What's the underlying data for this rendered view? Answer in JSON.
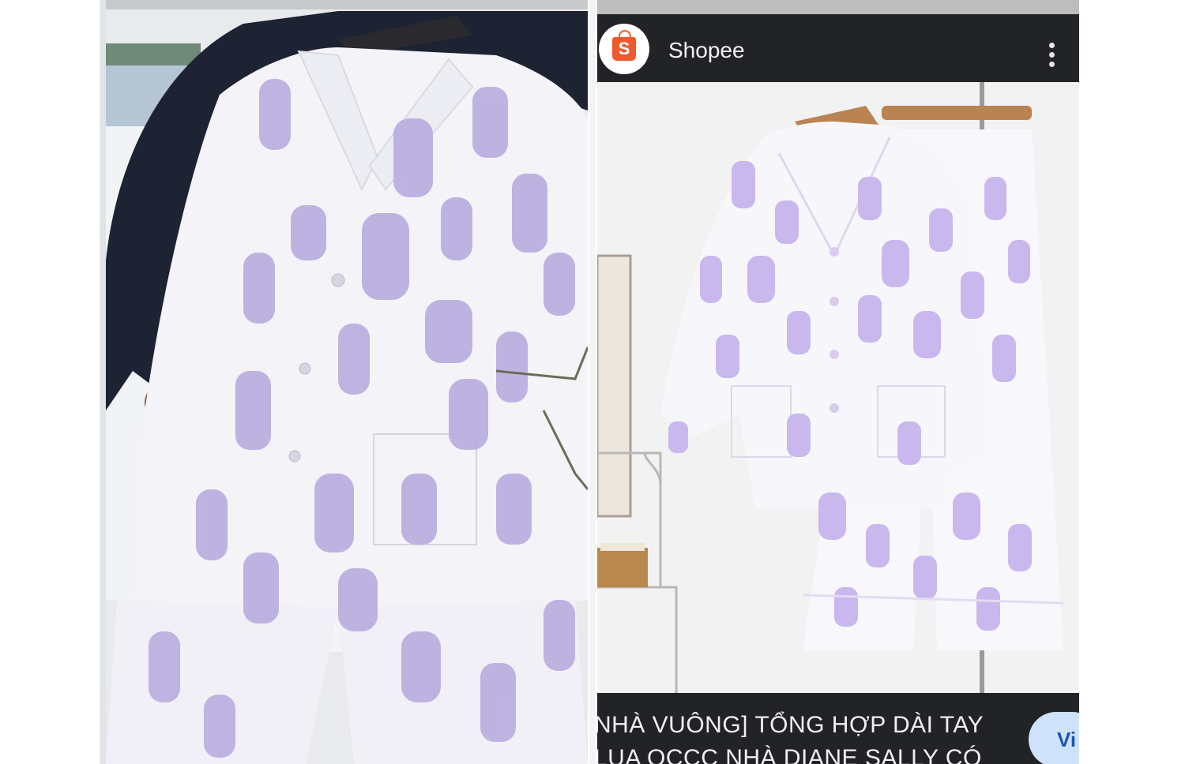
{
  "left_photo": {
    "description_icon": "pajama-shirt-on-hanger-photo"
  },
  "shopee": {
    "app_name": "Shopee",
    "logo_letter": "S",
    "brand_color": "#f1582c",
    "header_color": "#222327",
    "menu_icon": "kebab-menu-icon",
    "caption_line_1": "NHÀ VUÔNG] TỔNG HỢP DÀI TAY",
    "caption_line_2": "LỤA QCCC NHÀ DIANE SALLY CÓ",
    "visit_button_label": "Vi"
  },
  "colors": {
    "print_lilac": "#b9acdf",
    "fabric_white": "#f7f6fb"
  }
}
